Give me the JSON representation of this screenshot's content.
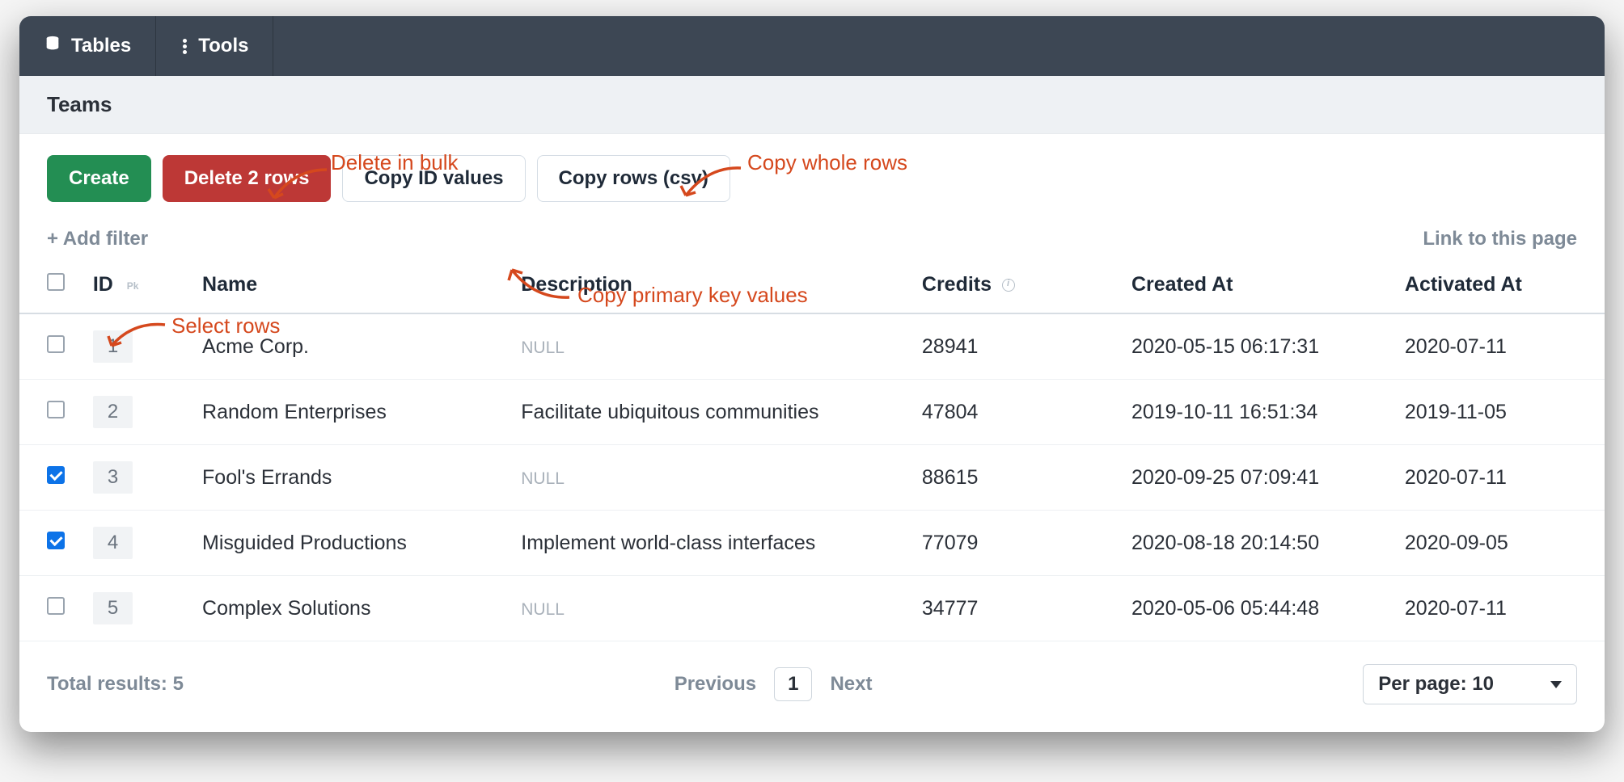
{
  "nav": {
    "tables_label": "Tables",
    "tools_label": "Tools"
  },
  "page": {
    "title": "Teams",
    "add_filter_label": "+ Add filter",
    "link_label": "Link to this page"
  },
  "actions": {
    "create_label": "Create",
    "delete_label": "Delete 2 rows",
    "copy_ids_label": "Copy ID values",
    "copy_csv_label": "Copy rows (csv)"
  },
  "columns": {
    "id": "ID",
    "pk_badge": "Pk",
    "name": "Name",
    "description": "Description",
    "credits": "Credits",
    "created_at": "Created At",
    "activated_at": "Activated At"
  },
  "rows": [
    {
      "checked": false,
      "id": "1",
      "name": "Acme Corp.",
      "description": null,
      "credits": "28941",
      "created_at": "2020-05-15 06:17:31",
      "activated_at": "2020-07-11"
    },
    {
      "checked": false,
      "id": "2",
      "name": "Random Enterprises",
      "description": "Facilitate ubiquitous communities",
      "credits": "47804",
      "created_at": "2019-10-11 16:51:34",
      "activated_at": "2019-11-05"
    },
    {
      "checked": true,
      "id": "3",
      "name": "Fool's Errands",
      "description": null,
      "credits": "88615",
      "created_at": "2020-09-25 07:09:41",
      "activated_at": "2020-07-11"
    },
    {
      "checked": true,
      "id": "4",
      "name": "Misguided Productions",
      "description": "Implement world-class interfaces",
      "credits": "77079",
      "created_at": "2020-08-18 20:14:50",
      "activated_at": "2020-09-05"
    },
    {
      "checked": false,
      "id": "5",
      "name": "Complex Solutions",
      "description": null,
      "credits": "34777",
      "created_at": "2020-05-06 05:44:48",
      "activated_at": "2020-07-11"
    }
  ],
  "null_text": "NULL",
  "footer": {
    "total_label": "Total results: 5",
    "prev_label": "Previous",
    "page": "1",
    "next_label": "Next",
    "per_page_label": "Per page: 10"
  },
  "annotations": {
    "delete_bulk": "Delete in bulk",
    "copy_rows": "Copy whole rows",
    "copy_pk": "Copy primary key values",
    "select_rows": "Select rows"
  }
}
